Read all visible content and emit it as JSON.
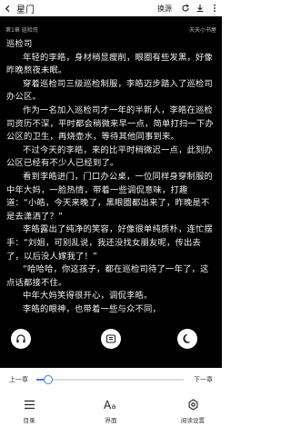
{
  "header": {
    "title": "星门",
    "swap_source_label": "换源"
  },
  "reader": {
    "chapter_meta": "第1章 巡检司",
    "chapter_meta_right": "天天小书屋",
    "paragraphs": [
      "巡检司",
      "年轻的李皓，身材稍显瘦削，眼圈有些发黑，好像昨晚熬夜未眠。",
      "穿着巡检司三级巡检制服，李皓迈步踏入了巡检司办公区。",
      "作为一名加入巡检司才一年的半新人，李皓在巡检司资历不深，平时都会稍微来早一点，简单打扫一下办公区的卫生，再烧壶水，等待其他同事到来。",
      "不过今天的李皓，来的比平时稍微迟一点，此刻办公区已经有不少人已经到了。",
      "看到李皓进门，门口办公桌，一位同样身穿制服的中年大妈，一脸热情，带着一些调侃意味，打趣道：“小皓，今天来晚了，黑眼圈都出来了，昨晚是不是去潇洒了？”",
      "李皓露出了纯净的笑容，好像很单纯质朴，连忙摆手：“刘姐，可别乱说，我还没找女朋友呢，传出去了，以后没人嫁我了！”",
      "“哈哈哈，你这孩子，都在巡检司待了一年了，这点话都接不住。",
      "中年大妈笑得很开心，调侃李皓。",
      "李皓的眼神，也带着一些与众不同，"
    ]
  },
  "floating_buttons": {
    "listen": "headphones-icon",
    "menu": "bookmark-icon",
    "night": "moon-icon"
  },
  "progress": {
    "prev_label": "上一章",
    "next_label": "下一章",
    "value": 0.08
  },
  "toolbar": {
    "catalog_label": "目录",
    "font_label": "界面",
    "settings_label": "阅读设置"
  },
  "colors": {
    "accent": "#4a78e8",
    "reader_background": "#000000",
    "reader_text": "#f2f2f2"
  }
}
